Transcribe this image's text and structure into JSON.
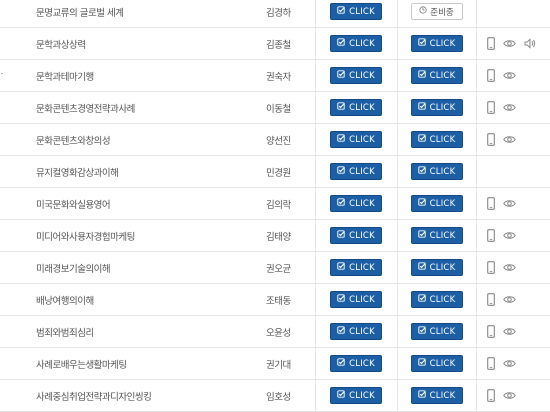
{
  "colors": {
    "button_blue": "#1d5fa5",
    "border": "#e6e6e6",
    "text": "#555555",
    "icon": "#888888"
  },
  "icons": {
    "phone": "mobile-phone-icon",
    "view": "eye-icon",
    "audio": "speaker-icon",
    "check": "checkbox-icon",
    "clock": "clock-icon"
  },
  "rows": [
    {
      "title": "문명교류의 글로벌 세계",
      "professor": "김경하",
      "btn1": "CLICK",
      "btn2": "준비중",
      "btn2_prep": true,
      "mobile": false,
      "view": false,
      "audio": false
    },
    {
      "title": "문학과상상력",
      "professor": "김종철",
      "btn1": "CLICK",
      "btn2": "CLICK",
      "btn2_prep": false,
      "mobile": true,
      "view": true,
      "audio": true
    },
    {
      "title": "문학과테마기행",
      "professor": "권숙자",
      "btn1": "CLICK",
      "btn2": "CLICK",
      "btn2_prep": false,
      "mobile": true,
      "view": true,
      "audio": false
    },
    {
      "title": "문화콘텐츠경영전략과사례",
      "professor": "이동철",
      "btn1": "CLICK",
      "btn2": "CLICK",
      "btn2_prep": false,
      "mobile": true,
      "view": true,
      "audio": false
    },
    {
      "title": "문화콘텐츠와창의성",
      "professor": "양선진",
      "btn1": "CLICK",
      "btn2": "CLICK",
      "btn2_prep": false,
      "mobile": true,
      "view": true,
      "audio": false
    },
    {
      "title": "뮤지컬영화감상과이해",
      "professor": "민경원",
      "btn1": "CLICK",
      "btn2": "CLICK",
      "btn2_prep": false,
      "mobile": false,
      "view": false,
      "audio": false
    },
    {
      "title": "미국문화와실용영어",
      "professor": "김의락",
      "btn1": "CLICK",
      "btn2": "CLICK",
      "btn2_prep": false,
      "mobile": true,
      "view": true,
      "audio": false
    },
    {
      "title": "미디어와사용자경험마케팅",
      "professor": "김태양",
      "btn1": "CLICK",
      "btn2": "CLICK",
      "btn2_prep": false,
      "mobile": true,
      "view": true,
      "audio": false
    },
    {
      "title": "미래경보기술의이해",
      "professor": "권오균",
      "btn1": "CLICK",
      "btn2": "CLICK",
      "btn2_prep": false,
      "mobile": true,
      "view": true,
      "audio": false
    },
    {
      "title": "배낭여행의이해",
      "professor": "조태동",
      "btn1": "CLICK",
      "btn2": "CLICK",
      "btn2_prep": false,
      "mobile": true,
      "view": true,
      "audio": false
    },
    {
      "title": "범죄와범죄심리",
      "professor": "오윤성",
      "btn1": "CLICK",
      "btn2": "CLICK",
      "btn2_prep": false,
      "mobile": true,
      "view": true,
      "audio": false
    },
    {
      "title": "사례로배우는생활마케팅",
      "professor": "권기대",
      "btn1": "CLICK",
      "btn2": "CLICK",
      "btn2_prep": false,
      "mobile": true,
      "view": true,
      "audio": false
    },
    {
      "title": "사례중심취업전략과디자인씽킹",
      "professor": "임호성",
      "btn1": "CLICK",
      "btn2": "CLICK",
      "btn2_prep": false,
      "mobile": true,
      "view": true,
      "audio": false
    }
  ]
}
